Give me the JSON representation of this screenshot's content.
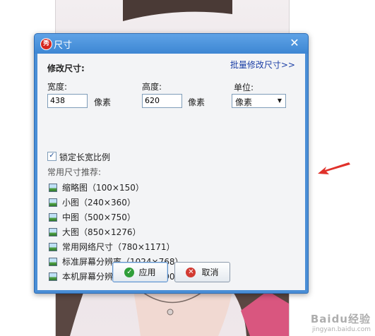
{
  "background": {
    "watermark_text": "Baidu经验",
    "watermark_sub": "jingyan.baidu.com",
    "arrow_color": "#e0312a"
  },
  "dialog": {
    "title": "尺寸",
    "app_icon_text": "秀",
    "close_glyph": "✕",
    "section_title": "修改尺寸:",
    "batch_link": "批量修改尺寸>>",
    "width": {
      "label": "宽度:",
      "value": "438",
      "unit": "像素"
    },
    "height": {
      "label": "高度:",
      "value": "620",
      "unit": "像素"
    },
    "unit_select": {
      "label": "单位:",
      "selected": "像素"
    },
    "lock_ratio": {
      "label": "锁定长宽比例",
      "checked": true
    },
    "presets_heading": "常用尺寸推荐:",
    "presets": [
      {
        "label": "缩略图（100×150）"
      },
      {
        "label": "小图（240×360）"
      },
      {
        "label": "中图（500×750）"
      },
      {
        "label": "大图（850×1276）"
      },
      {
        "label": "常用网络尺寸（780×1171）"
      },
      {
        "label": "标准屏幕分辨率（1024×768）"
      },
      {
        "label": "本机屏幕分辨率（1440 × 900）"
      }
    ],
    "ok_label": "应用",
    "cancel_label": "取消"
  },
  "colors": {
    "title_bar": "#3d86d3",
    "link": "#1b3fa6",
    "ok_icon": "#2f9e3a",
    "cancel_icon": "#d23b33"
  }
}
